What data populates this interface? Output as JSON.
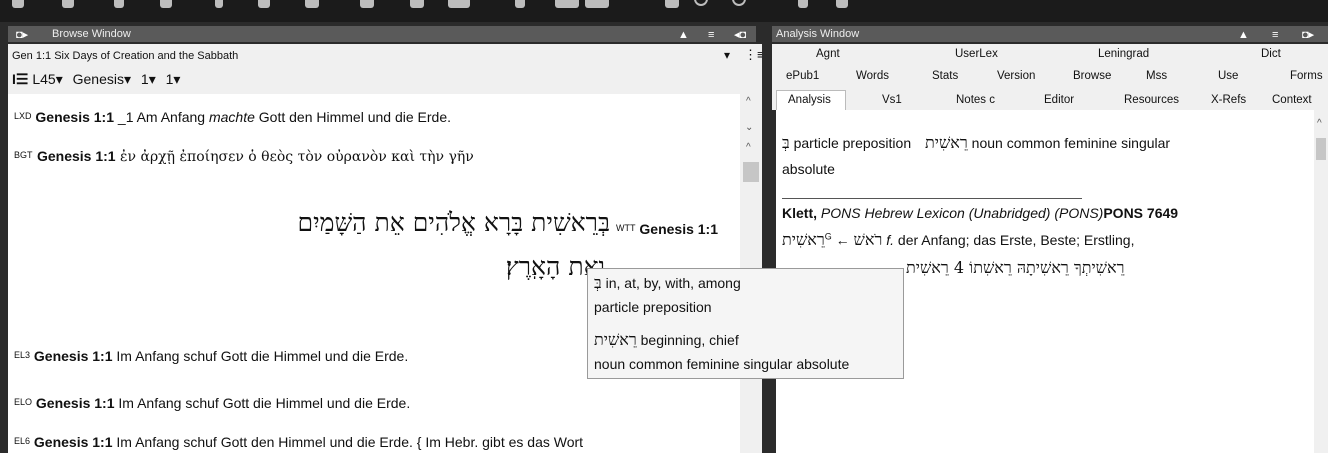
{
  "browse": {
    "title": "Browse Window",
    "subtitle": "Gen 1:1 Six Days of Creation and the Sabbath",
    "toolbar": {
      "version": "L45▾",
      "book": "Genesis▾",
      "chapter": "1▾",
      "verse": "1▾"
    },
    "verses": [
      {
        "sigla": "LXD",
        "ref": "Genesis 1:1",
        "pre": " _1 Am Anfang ",
        "ital": "machte",
        "post": " Gott den Himmel und die Erde."
      },
      {
        "sigla": "BGT",
        "ref": "Genesis 1:1",
        "text": " ἐν ἀρχῇ ἐποίησεν ὁ θεὸς τὸν οὐρανὸν καὶ τὴν γῆν"
      },
      {
        "sigla": "WTT",
        "ref": "Genesis 1:1",
        "hebrew1": "בְּרֵאשִׁית בָּרָא אֱלֹהִים אֵת הַשָּׁמַיִם",
        "hebrew2": "וְאֵת הָאָֽרֶץ׃"
      },
      {
        "sigla": "EL3",
        "ref": "Genesis 1:1",
        "text": " Im Anfang schuf Gott die Himmel und die Erde."
      },
      {
        "sigla": "ELO",
        "ref": "Genesis 1:1",
        "text": " Im Anfang schuf Gott die Himmel und die Erde."
      },
      {
        "sigla": "EL6",
        "ref": "Genesis 1:1",
        "text": " Im Anfang schuf Gott den Himmel und die Erde. { Im Hebr. gibt es das Wort"
      }
    ]
  },
  "tooltip": {
    "word1": "בְּ",
    "gloss1": "in, at, by, with, among",
    "parse1": "particle preposition",
    "word2": "רֵאשִׁית",
    "gloss2": "beginning, chief",
    "parse2": "noun common feminine singular absolute"
  },
  "analysis": {
    "title": "Analysis Window",
    "tabs_row1": [
      "Agnt",
      "UserLex",
      "Leningrad",
      "Dict"
    ],
    "tabs_row2": [
      "ePub1",
      "Words",
      "Stats",
      "Version",
      "Browse",
      "Mss",
      "Use",
      "Forms"
    ],
    "tabs_row3": [
      "Analysis",
      "Vs1",
      "Notes c",
      "Editor",
      "Resources",
      "X-Refs",
      "Context"
    ],
    "active_tab": "Analysis",
    "parse_heb1": "בְּ",
    "parse_text1": "particle preposition",
    "parse_heb2": "רֵאשִׁית",
    "parse_text2": "noun common feminine singular",
    "parse_text3": "absolute",
    "lex_head": "Klett,",
    "lex_title": "PONS Hebrew Lexicon (Unabridged) (PONS)",
    "lex_num": "PONS 7649",
    "lex_line2_heb": "רֵאשִׁית",
    "lex_line2_sup": "G",
    "lex_arrow": "←",
    "lex_root": "רֹאשׁ",
    "lex_gloss_i": "f.",
    "lex_gloss": "der Anfang; das Erste, Beste; Erstling,",
    "lex_line3": "רֵאשִׁיתְךָ רֵאשִׁיתָהּ רֵאשִׁתוֹ 4 רֵאשִׁית"
  }
}
